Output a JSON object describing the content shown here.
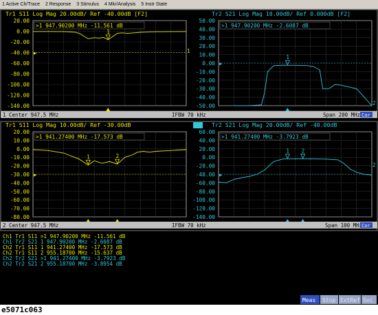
{
  "menu": [
    {
      "label": "1 Active Ch/Trace"
    },
    {
      "label": "2 Response"
    },
    {
      "label": "3 Stimulus"
    },
    {
      "label": "4 Mkr/Analysis"
    },
    {
      "label": "5 Instr State"
    }
  ],
  "yellow_color": "#e8e800",
  "cyan_color": "#33c8d8",
  "ch1": {
    "status_left": "1  Center 947.5 MHz",
    "status_mid": "IFBW 70 kHz",
    "status_right": "Span 200 MHz",
    "status_badge": "Cor"
  },
  "ch2": {
    "status_left": "2  Center 947.5 MHz",
    "status_mid": "IFBW 70 kHz",
    "status_right": "Span 100 MHz",
    "status_badge": "Cor"
  },
  "panels": [
    {
      "header": "Tr1 S11 Log Mag 20.00dB/ Ref -40.00dB [F2]",
      "marker_readout": ">1  947.90200 MHz -11.561 dB",
      "ticks": [
        "20.00",
        "0.00",
        "-20.00",
        "-40.00",
        "-60.00",
        "-80.00",
        "-100.00",
        "-120.00",
        "-140.00"
      ],
      "marker_labels": [
        "1"
      ],
      "end_label": "1",
      "trace": {
        "color": "#e8e800",
        "ylim": [
          -140,
          20
        ],
        "ref": -40,
        "x": [
          0,
          0.1,
          0.2,
          0.28,
          0.31,
          0.33,
          0.36,
          0.4,
          0.43,
          0.46,
          0.49,
          0.52,
          0.55,
          0.58,
          0.62,
          0.66,
          0.7,
          0.75,
          0.8,
          0.9,
          1
        ],
        "y": [
          -0.5,
          -0.5,
          -0.8,
          -2,
          -5,
          -9,
          -14,
          -12,
          -13,
          -11.6,
          -16,
          -10,
          -4,
          -3,
          -4,
          -3,
          -2,
          -1.5,
          -1,
          -0.8,
          -0.5
        ]
      }
    },
    {
      "header": "Tr2 S21 Log Mag 10.00dB/ Ref 0.000dB [F2]",
      "marker_readout": ">1  947.90200 MHz -2.6087 dB",
      "ticks": [
        "50.00",
        "40.00",
        "30.00",
        "20.00",
        "10.00",
        "0.00",
        "-10.00",
        "-20.00",
        "-30.00",
        "-40.00",
        "-50.00"
      ],
      "marker_labels": [
        "1"
      ],
      "end_label": "2",
      "trace": {
        "color": "#33c8d8",
        "ylim": [
          -50,
          50
        ],
        "ref": 0,
        "x": [
          0.1,
          0.2,
          0.28,
          0.3,
          0.32,
          0.36,
          0.42,
          0.5,
          0.58,
          0.62,
          0.66,
          0.68,
          0.72,
          0.76,
          0.8,
          0.85,
          0.9,
          0.95,
          1
        ],
        "y": [
          -50,
          -50,
          -49,
          -35,
          -10,
          -3,
          -2.5,
          -2.6,
          -3,
          -4,
          -8,
          -30,
          -30,
          -25,
          -26,
          -28,
          -30,
          -40,
          -50
        ]
      }
    },
    {
      "header": "Tr1 S11 Log Mag 10.00dB/ Ref -30.00dB",
      "marker_readout": ">1  941.27400 MHz -17.573 dB",
      "ticks": [
        "20.00",
        "10.00",
        "0.00",
        "-10.00",
        "-20.00",
        "-30.00",
        "-40.00",
        "-50.00",
        "-60.00",
        "-70.00",
        "-80.00"
      ],
      "marker_labels": [
        "1",
        "2"
      ],
      "end_label": "",
      "trace": {
        "color": "#e8e800",
        "ylim": [
          -80,
          20
        ],
        "ref": -30,
        "x": [
          0,
          0.1,
          0.2,
          0.3,
          0.36,
          0.4,
          0.45,
          0.5,
          0.55,
          0.6,
          0.65,
          0.68,
          0.72,
          0.76,
          0.8,
          0.9,
          1
        ],
        "y": [
          -1,
          -2,
          -5,
          -12,
          -19,
          -14,
          -17,
          -15,
          -18,
          -10,
          -7,
          -4,
          -3,
          -4,
          -3,
          -2,
          -1
        ]
      }
    },
    {
      "header": "Tr2 S21 Log Mag 20.00dB/ Ref -40.00dB",
      "marker_readout": ">1  941.27400 MHz -3.7923 dB",
      "ticks": [
        "60.00",
        "40.00",
        "20.00",
        "0.00",
        "-20.00",
        "-40.00",
        "-60.00",
        "-80.00",
        "-100.00",
        "-120.00",
        "-140.00"
      ],
      "marker_labels": [
        "1",
        "2"
      ],
      "end_label": "2",
      "trace": {
        "color": "#33c8d8",
        "ylim": [
          -140,
          60
        ],
        "ref": -40,
        "x": [
          0,
          0.05,
          0.1,
          0.15,
          0.2,
          0.25,
          0.3,
          0.36,
          0.42,
          0.5,
          0.6,
          0.7,
          0.78,
          0.82,
          0.86,
          0.9,
          0.95,
          1
        ],
        "y": [
          -58,
          -60,
          -52,
          -48,
          -45,
          -40,
          -30,
          -10,
          -4,
          -3.8,
          -3.9,
          -4.2,
          -6,
          -15,
          -28,
          -35,
          -40,
          -42
        ]
      }
    }
  ],
  "marker_table": [
    {
      "col": "yellow",
      "text": "Ch1 Tr1 S11  >1  947.90200 MHz -11.561  dB"
    },
    {
      "col": "cyan",
      "text": "Ch1 Tr2 S21   1  947.90200 MHz -2.6087  dB"
    },
    {
      "col": "yellow",
      "text": "Ch2 Tr1 S11   1  941.27400 MHz -17.573  dB"
    },
    {
      "col": "yellow",
      "text": "Ch2 Tr1 S11   2  955.18700 MHz -15.637  dB"
    },
    {
      "col": "cyan",
      "text": "Ch2 Tr2 S21  >1  941.27400 MHz -3.7923  dB"
    },
    {
      "col": "cyan",
      "text": "Ch2 Tr2 S21   2  955.18700 MHz -3.8954  dB"
    }
  ],
  "softkeys": [
    "Meas",
    "Stop",
    "ExtRef",
    "Svc"
  ],
  "caption": "e5071c063"
}
